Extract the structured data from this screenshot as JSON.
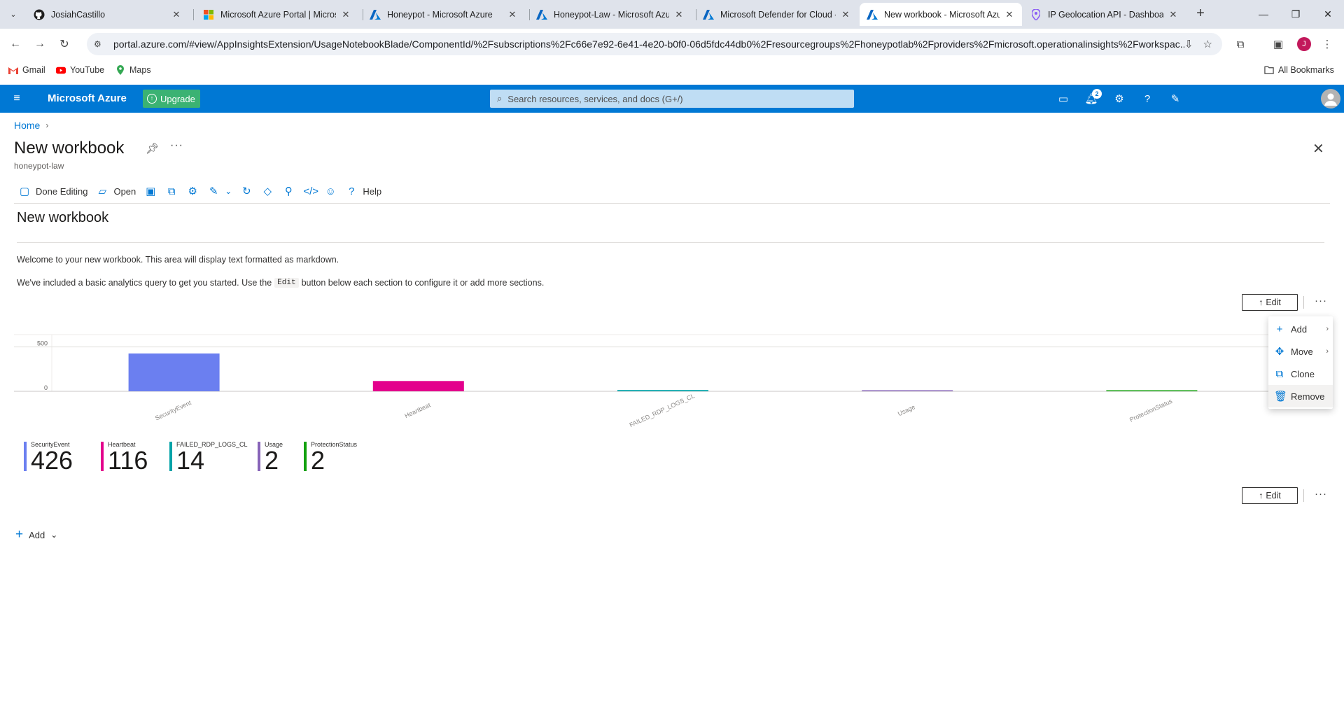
{
  "browser": {
    "tabs": [
      {
        "label": "JosiahCastillo",
        "icon": "github-icon"
      },
      {
        "label": "Microsoft Azure Portal | Microsoft",
        "icon": "microsoft-icon"
      },
      {
        "label": "Honeypot - Microsoft Azure",
        "icon": "azure-icon"
      },
      {
        "label": "Honeypot-Law - Microsoft Azure",
        "icon": "azure-icon"
      },
      {
        "label": "Microsoft Defender for Cloud - ",
        "icon": "azure-icon"
      },
      {
        "label": "New workbook - Microsoft Azure",
        "icon": "azure-icon",
        "active": true
      },
      {
        "label": "IP Geolocation API - Dashboard",
        "icon": "pin-icon"
      }
    ],
    "url": "portal.azure.com/#view/AppInsightsExtension/UsageNotebookBlade/ComponentId/%2Fsubscriptions%2Fc66e7e92-6e41-4e20-b0f0-06d5fdc44db0%2Fresourcegroups%2Fhoneypotlab%2Fproviders%2Fmicrosoft.operationalinsights%2Fworkspac...",
    "profile_initial": "J",
    "bookmarks": [
      {
        "label": "Gmail"
      },
      {
        "label": "YouTube"
      },
      {
        "label": "Maps"
      }
    ],
    "all_bookmarks": "All Bookmarks"
  },
  "azure": {
    "brand": "Microsoft Azure",
    "upgrade": "Upgrade",
    "search_placeholder": "Search resources, services, and docs (G+/)",
    "notification_count": "2"
  },
  "blade": {
    "breadcrumb": [
      "Home"
    ],
    "title": "New workbook",
    "subtitle": "honeypot-law",
    "commands": {
      "done_editing": "Done Editing",
      "open": "Open",
      "help": "Help"
    }
  },
  "workbook": {
    "heading": "New workbook",
    "text1": "Welcome to your new workbook. This area will display text formatted as markdown.",
    "text2_before": "We've included a basic analytics query to get you started. Use the",
    "text2_code": "Edit",
    "text2_after": "button below each section to configure it or add more sections.",
    "edit_label": "Edit",
    "add_label": "Add"
  },
  "context_menu": {
    "items": [
      {
        "label": "Add",
        "submenu": true
      },
      {
        "label": "Move",
        "submenu": true
      },
      {
        "label": "Clone",
        "submenu": false
      },
      {
        "label": "Remove",
        "submenu": false
      }
    ]
  },
  "chart_data": {
    "type": "bar",
    "categories": [
      "SecurityEvent",
      "Heartbeat",
      "FAILED_RDP_LOGS_CL",
      "Usage",
      "ProtectionStatus"
    ],
    "values": [
      426,
      116,
      14,
      2,
      2
    ],
    "colors": [
      "#6b7ff0",
      "#e3008c",
      "#00a3a8",
      "#8764b8",
      "#13a10e"
    ],
    "ytick_labels": [
      "0",
      "500"
    ],
    "ylim": [
      0,
      560
    ],
    "grid": true
  },
  "tiles": [
    {
      "name": "SecurityEvent",
      "value": "426",
      "color": "#6b7ff0"
    },
    {
      "name": "Heartbeat",
      "value": "116",
      "color": "#e3008c"
    },
    {
      "name": "FAILED_RDP_LOGS_CL",
      "value": "14",
      "color": "#00a3a8"
    },
    {
      "name": "Usage",
      "value": "2",
      "color": "#8764b8"
    },
    {
      "name": "ProtectionStatus",
      "value": "2",
      "color": "#13a10e"
    }
  ]
}
